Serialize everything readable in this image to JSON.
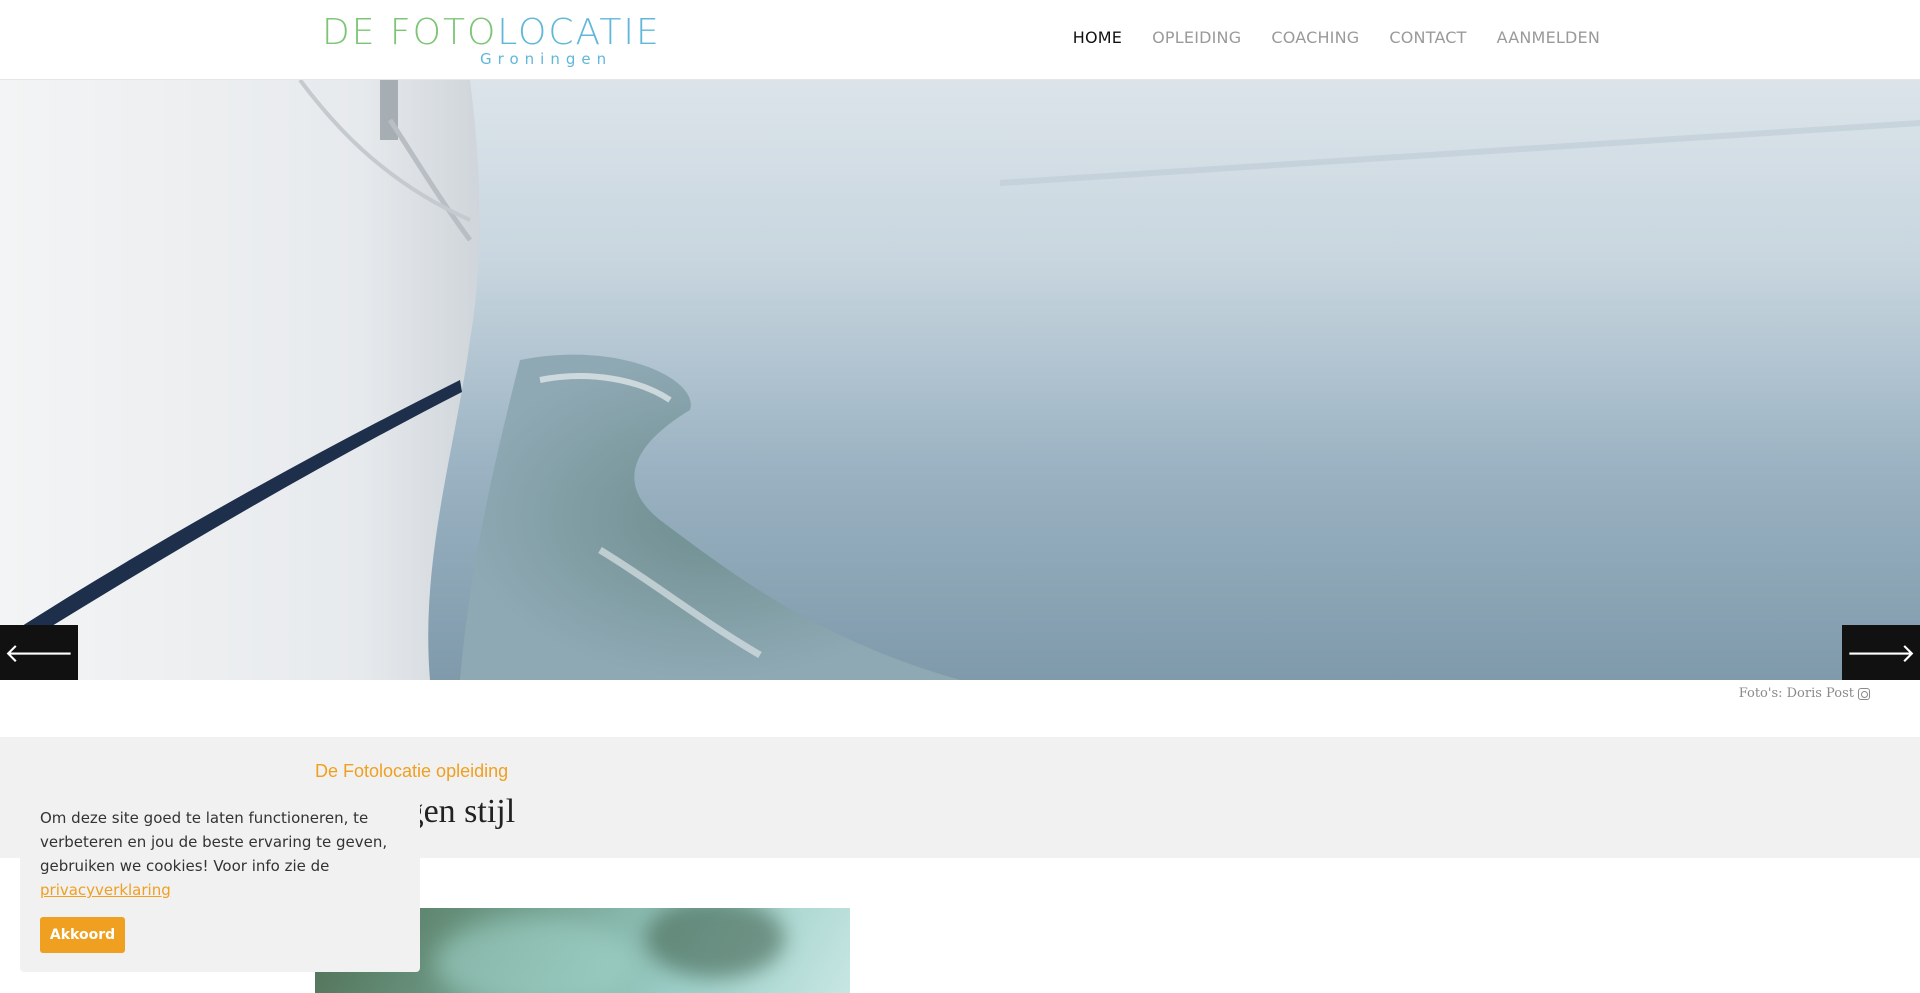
{
  "header": {
    "logo": {
      "main_green": "DE FOTO",
      "main_blue": "LOCATIE",
      "sub": "Groningen"
    },
    "nav": [
      {
        "label": "HOME",
        "active": true
      },
      {
        "label": "OPLEIDING",
        "active": false
      },
      {
        "label": "COACHING",
        "active": false
      },
      {
        "label": "CONTACT",
        "active": false
      },
      {
        "label": "AANMELDEN",
        "active": false
      }
    ]
  },
  "hero": {
    "prev_icon": "arrow-left-icon",
    "next_icon": "arrow-right-icon",
    "prev_glyph": "🡐",
    "next_glyph": "🡒",
    "credit": "Foto's: Doris Post",
    "credit_icon": "instagram-icon"
  },
  "intro": {
    "kicker": "De Fotolocatie opleiding",
    "title": "ouw eigen stijl"
  },
  "cookie": {
    "text": "Om deze site goed te laten functioneren, te verbeteren en jou de beste ervaring te geven, gebruiken we cookies! Voor info zie de",
    "link": "privacyverklaring",
    "button": "Akkoord"
  },
  "colors": {
    "accent": "#f0a020",
    "logo_green": "#7cc576",
    "logo_blue": "#5fb7d9",
    "arrow_bg": "#111111",
    "section_bg": "#f1f1f1"
  }
}
